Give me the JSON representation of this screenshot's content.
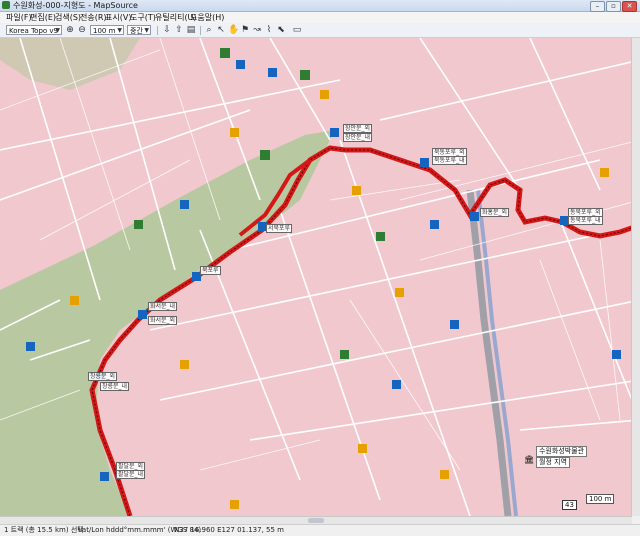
{
  "window": {
    "title": "수원화성-000-지형도 - MapSource",
    "buttons": [
      "–",
      "▫",
      "✕"
    ]
  },
  "menu": [
    "파일(F)",
    "편집(E)",
    "검색(S)",
    "전송(R)",
    "표시(V)",
    "도구(T)",
    "유틸리티(U)",
    "도움말(H)"
  ],
  "toolbar": {
    "product_select": "Korea Topo v9",
    "zoom_select": "100 m",
    "detail_select": "중간"
  },
  "map": {
    "track_labels": [
      "팔달문_내",
      "팔달문_외",
      "북동포루_외",
      "북동포루_내",
      "화홍문_외",
      "동북포루_외",
      "동북포루_내",
      "서북포루",
      "북포루",
      "화서문_내",
      "화서문_외",
      "장안문_외",
      "장안문_내",
      "창룡문_외",
      "창룡문_내"
    ],
    "poi_label": "수원화성박물관",
    "poi_sublabel": "월정 지역",
    "scale_label": "100 m",
    "road_badge": "43"
  },
  "status": {
    "selection": "1 트랙 (총 15.5 km) 선택",
    "coord_format": "Lat/Lon hddd°mm.mmm' (WGS 84)",
    "position": "N37 16.960 E127 01.137, 55 m"
  },
  "colors": {
    "map_background": "#f2c8cf",
    "park_green": "#b8c8a0",
    "track_red": "#d41818",
    "river_blue": "#9aa8d0",
    "road_white": "#ffffff",
    "highway_gray": "#a0a0a8"
  }
}
